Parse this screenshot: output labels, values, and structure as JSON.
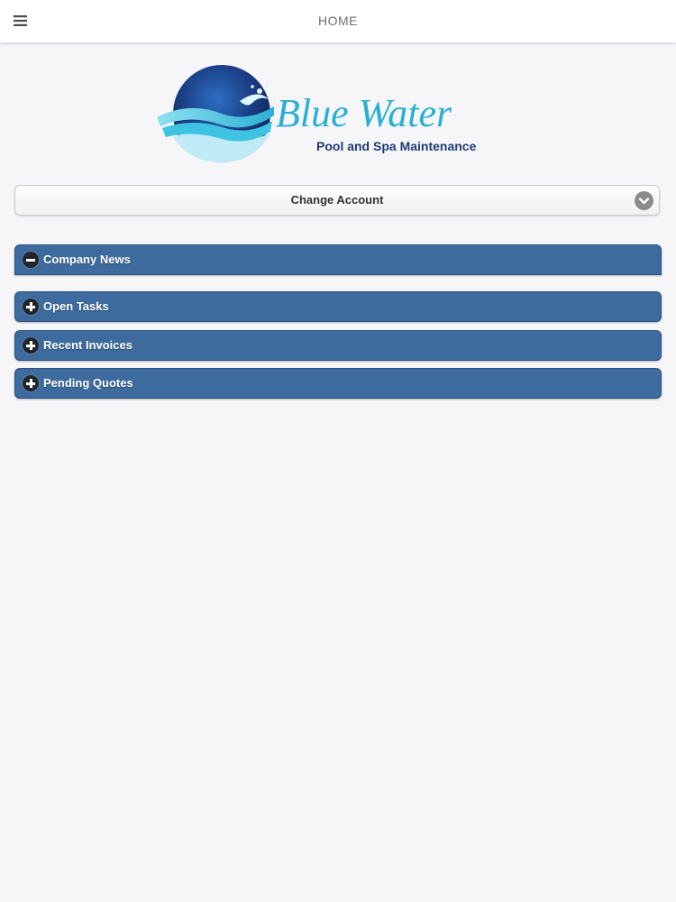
{
  "header": {
    "title": "HOME",
    "menu_icon": "hamburger-menu-icon"
  },
  "logo": {
    "brand": "Blue Water",
    "tagline": "Pool and Spa Maintenance"
  },
  "account_select": {
    "label": "Change Account",
    "chevron_icon": "chevron-down-icon"
  },
  "panels": [
    {
      "label": "Company News",
      "state": "expanded",
      "icon": "minus-icon"
    },
    {
      "label": "Open Tasks",
      "state": "collapsed",
      "icon": "plus-icon"
    },
    {
      "label": "Recent Invoices",
      "state": "collapsed",
      "icon": "plus-icon"
    },
    {
      "label": "Pending Quotes",
      "state": "collapsed",
      "icon": "plus-icon"
    }
  ],
  "colors": {
    "panel_blue": "#3d6b9e",
    "logo_navy": "#1b3f86",
    "logo_cyan": "#2ab0d4",
    "tagline_navy": "#1d3a7a"
  }
}
